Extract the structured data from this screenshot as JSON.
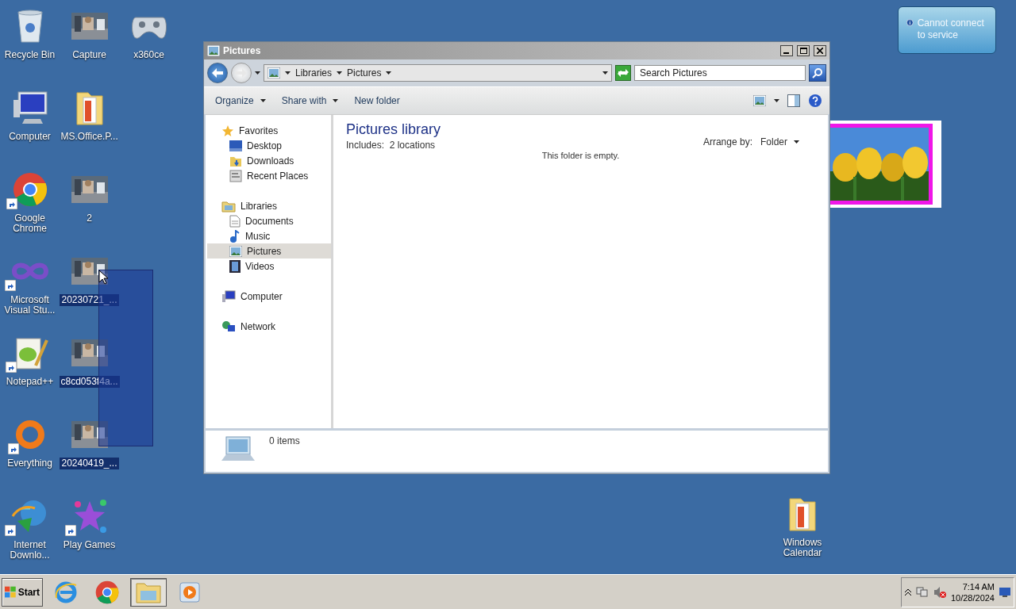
{
  "desktop": {
    "columns": [
      {
        "icons": [
          {
            "label": "Recycle Bin",
            "kind": "recycle",
            "shortcut": false,
            "selected": false
          },
          {
            "label": "Computer",
            "kind": "computer",
            "shortcut": false,
            "selected": false
          },
          {
            "label": "Google Chrome",
            "kind": "chrome",
            "shortcut": true,
            "selected": false
          },
          {
            "label": "Microsoft Visual Stu...",
            "kind": "vs",
            "shortcut": true,
            "selected": false
          },
          {
            "label": "Notepad++",
            "kind": "notepad",
            "shortcut": true,
            "selected": false
          },
          {
            "label": "Everything",
            "kind": "everything",
            "shortcut": true,
            "selected": false
          },
          {
            "label": "Internet Downlo...",
            "kind": "idm",
            "shortcut": true,
            "selected": false
          }
        ]
      },
      {
        "icons": [
          {
            "label": "Capture",
            "kind": "thumbnail",
            "shortcut": false,
            "selected": false
          },
          {
            "label": "MS.Office.P...",
            "kind": "folder",
            "shortcut": false,
            "selected": false
          },
          {
            "label": "2",
            "kind": "thumbnail",
            "shortcut": false,
            "selected": false
          },
          {
            "label": "20230721_...",
            "kind": "thumbnail",
            "shortcut": false,
            "selected": true
          },
          {
            "label": "c8cd053f4a...",
            "kind": "thumbnail",
            "shortcut": false,
            "selected": true
          },
          {
            "label": "20240419_...",
            "kind": "thumbnail",
            "shortcut": false,
            "selected": true
          },
          {
            "label": "Play Games",
            "kind": "games",
            "shortcut": true,
            "selected": false
          }
        ]
      },
      {
        "icons": [
          {
            "label": "x360ce",
            "kind": "gamepad",
            "shortcut": false,
            "selected": false
          }
        ]
      }
    ],
    "corner_icon": {
      "label": "Windows Calendar",
      "kind": "folder",
      "shortcut": false,
      "selected": false
    }
  },
  "notification": {
    "text": "Cannot connect to service"
  },
  "explorer": {
    "title": "Pictures",
    "breadcrumb": [
      "Libraries",
      "Pictures"
    ],
    "search": {
      "placeholder": "Search Pictures"
    },
    "toolbar": [
      {
        "label": "Organize",
        "dropdown": true
      },
      {
        "label": "Share with",
        "dropdown": true
      },
      {
        "label": "New folder",
        "dropdown": false
      }
    ],
    "nav": [
      {
        "label": "Favorites",
        "kind": "star",
        "selected": false,
        "children": [
          {
            "label": "Desktop",
            "kind": "desktop",
            "selected": false
          },
          {
            "label": "Downloads",
            "kind": "downloads",
            "selected": false
          },
          {
            "label": "Recent Places",
            "kind": "recent",
            "selected": false
          }
        ]
      },
      {
        "label": "Libraries",
        "kind": "library",
        "selected": false,
        "children": [
          {
            "label": "Documents",
            "kind": "document",
            "selected": false
          },
          {
            "label": "Music",
            "kind": "music",
            "selected": false
          },
          {
            "label": "Pictures",
            "kind": "pictures",
            "selected": true
          },
          {
            "label": "Videos",
            "kind": "video",
            "selected": false
          }
        ]
      },
      {
        "label": "Computer",
        "kind": "computer",
        "selected": false
      },
      {
        "label": "Network",
        "kind": "network",
        "selected": false
      }
    ],
    "header": {
      "title": "Pictures library",
      "subtitle": "Includes:  2 locations"
    },
    "arrange": {
      "label": "Arrange by:",
      "value": "Folder"
    },
    "empty_message": "This folder is empty.",
    "status": "0 items"
  },
  "taskbar": {
    "start": "Start",
    "buttons": [
      {
        "kind": "ie",
        "selected": false
      },
      {
        "kind": "chrome",
        "selected": false
      },
      {
        "kind": "explorer",
        "selected": true
      },
      {
        "kind": "media",
        "selected": false
      }
    ],
    "time": "7:14 AM",
    "date": "10/28/2024"
  }
}
